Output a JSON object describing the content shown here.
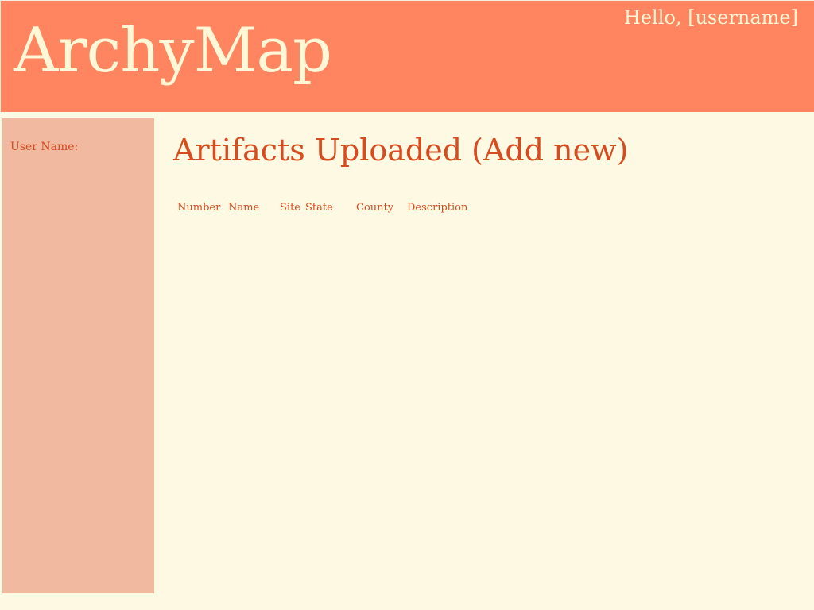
{
  "header": {
    "app_title": "ArchyMap",
    "greeting": "Hello, [username]"
  },
  "sidebar": {
    "user_name_label": "User Name:"
  },
  "main": {
    "section_title": "Artifacts Uploaded (Add new)",
    "table": {
      "columns": [
        "Number",
        "Name",
        "Site",
        "State",
        "County",
        "Description"
      ],
      "rows": []
    }
  },
  "colors": {
    "header_background": "#fe8560",
    "header_text": "#fff7d6",
    "sidebar_background": "#f0b9a0",
    "accent_text": "#d84b1f",
    "page_background": "#fef9e3"
  }
}
